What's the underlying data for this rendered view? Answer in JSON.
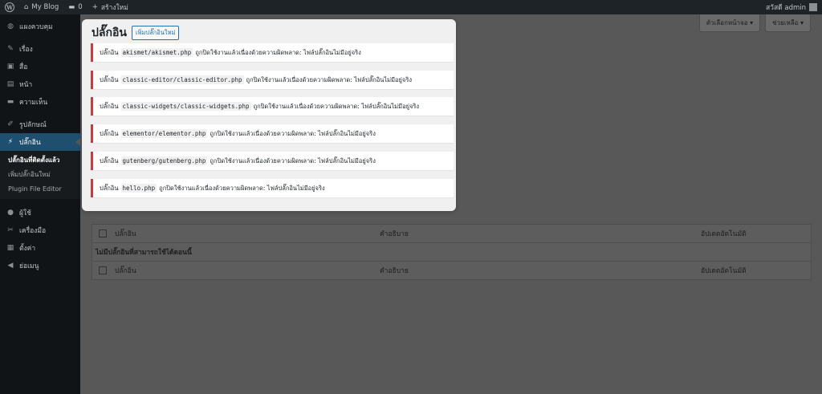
{
  "adminbar": {
    "site_name": "My Blog",
    "comments_count": "0",
    "new_label": "สร้างใหม่",
    "greeting": "สวัสดี admin"
  },
  "sidebar": {
    "items": [
      {
        "label": "แผงควบคุม",
        "icon": "dashboard-icon",
        "glyph": "◍"
      },
      {
        "label": "เรื่อง",
        "icon": "pin-icon",
        "glyph": "✎"
      },
      {
        "label": "สื่อ",
        "icon": "media-icon",
        "glyph": "▣"
      },
      {
        "label": "หน้า",
        "icon": "page-icon",
        "glyph": "▤"
      },
      {
        "label": "ความเห็น",
        "icon": "comment-icon",
        "glyph": "▬"
      },
      {
        "label": "รูปลักษณ์",
        "icon": "appearance-icon",
        "glyph": "✐"
      },
      {
        "label": "ปลั๊กอิน",
        "icon": "plugin-icon",
        "glyph": "⚡"
      },
      {
        "label": "ผู้ใช้",
        "icon": "user-icon",
        "glyph": "●"
      },
      {
        "label": "เครื่องมือ",
        "icon": "tools-icon",
        "glyph": "✂"
      },
      {
        "label": "ตั้งค่า",
        "icon": "settings-icon",
        "glyph": "▦"
      },
      {
        "label": "ย่อเมนู",
        "icon": "collapse-icon",
        "glyph": "◀"
      }
    ],
    "submenu": [
      "ปลั๊กอินที่ติดตั้งแล้ว",
      "เพิ่มปลั๊กอินใหม่",
      "Plugin File Editor"
    ]
  },
  "screen_options": {
    "screen_label": "ตัวเลือกหน้าจอ ▾",
    "help_label": "ช่วยเหลือ ▾"
  },
  "page": {
    "title": "ปลั๊กอิน",
    "add_new": "เพิ่มปลั๊กอินใหม่"
  },
  "notices": [
    {
      "prefix": "ปลั๊กอิน",
      "file": "akismet/akismet.php",
      "message": "ถูกปิดใช้งานแล้วเนื่องด้วยความผิดพลาด: ไฟล์ปลั๊กอินไม่มีอยู่จริง"
    },
    {
      "prefix": "ปลั๊กอิน",
      "file": "classic-editor/classic-editor.php",
      "message": "ถูกปิดใช้งานแล้วเนื่องด้วยความผิดพลาด: ไฟล์ปลั๊กอินไม่มีอยู่จริง"
    },
    {
      "prefix": "ปลั๊กอิน",
      "file": "classic-widgets/classic-widgets.php",
      "message": "ถูกปิดใช้งานแล้วเนื่องด้วยความผิดพลาด: ไฟล์ปลั๊กอินไม่มีอยู่จริง"
    },
    {
      "prefix": "ปลั๊กอิน",
      "file": "elementor/elementor.php",
      "message": "ถูกปิดใช้งานแล้วเนื่องด้วยความผิดพลาด: ไฟล์ปลั๊กอินไม่มีอยู่จริง"
    },
    {
      "prefix": "ปลั๊กอิน",
      "file": "gutenberg/gutenberg.php",
      "message": "ถูกปิดใช้งานแล้วเนื่องด้วยความผิดพลาด: ไฟล์ปลั๊กอินไม่มีอยู่จริง"
    },
    {
      "prefix": "ปลั๊กอิน",
      "file": "hello.php",
      "message": "ถูกปิดใช้งานแล้วเนื่องด้วยความผิดพลาด: ไฟล์ปลั๊กอินไม่มีอยู่จริง"
    }
  ],
  "table": {
    "col_plugin": "ปลั๊กอิน",
    "col_desc": "คำอธิบาย",
    "col_auto": "อัปเดตอัตโนมัติ",
    "empty_message": "ไม่มีปลั๊กอินที่สามารถใช้ได้ตอนนี้"
  },
  "colors": {
    "error_border": "#d63638",
    "link_blue": "#2271b1",
    "adminbar_bg": "#1d2327"
  }
}
